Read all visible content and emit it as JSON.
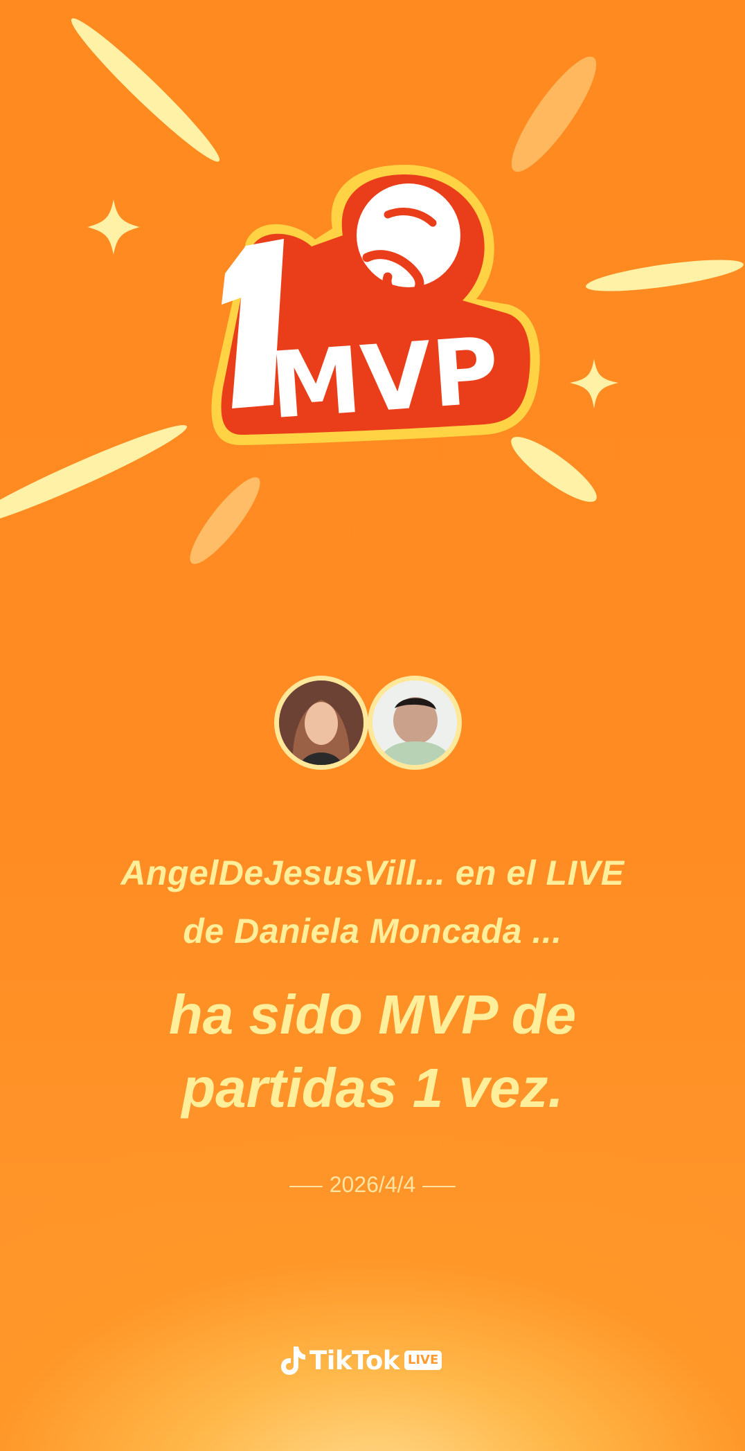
{
  "badge": {
    "rank": "1",
    "title": "MVP"
  },
  "message": {
    "line1": "AngelDeJesusVill... en el LIVE",
    "line2": "de Daniela Moncada ...",
    "headline1": "ha sido MVP de",
    "headline2": "partidas 1 vez."
  },
  "date": "2026/4/4",
  "brand": {
    "name": "TikTok",
    "badge": "LIVE"
  },
  "colors": {
    "background": "#ff8a20",
    "text_highlight": "#ffee9a",
    "badge_red": "#ea3d1a",
    "badge_yellow": "#ffd343"
  },
  "icons": [
    "sparkle-icon",
    "tiktok-note-icon"
  ]
}
